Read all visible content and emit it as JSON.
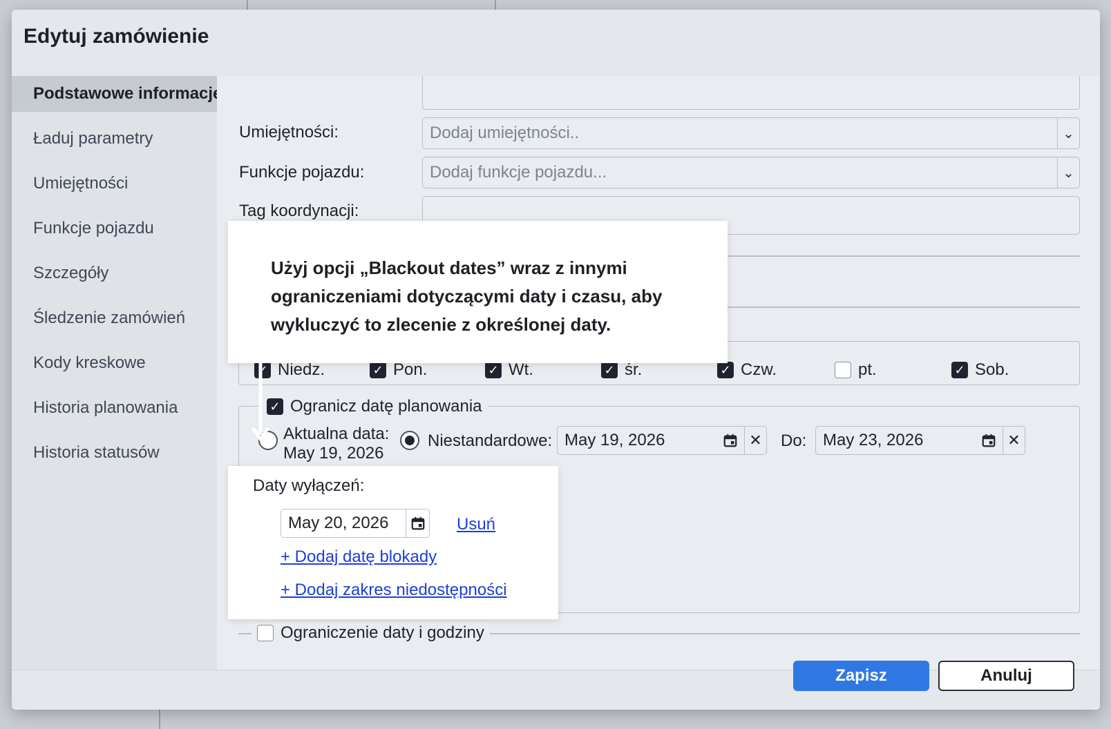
{
  "dialog": {
    "title": "Edytuj zamówienie"
  },
  "sidebar": {
    "items": [
      {
        "label": "Podstawowe informacje",
        "active": true
      },
      {
        "label": "Ładuj parametry"
      },
      {
        "label": "Umiejętności"
      },
      {
        "label": "Funkcje pojazdu"
      },
      {
        "label": "Szczegóły"
      },
      {
        "label": "Śledzenie zamówień"
      },
      {
        "label": "Kody kreskowe"
      },
      {
        "label": "Historia planowania"
      },
      {
        "label": "Historia statusów"
      }
    ]
  },
  "form": {
    "skills_label": "Umiejętności:",
    "skills_placeholder": "Dodaj umiejętności..",
    "vehicle_label": "Funkcje pojazdu:",
    "vehicle_placeholder": "Dodaj funkcje pojazdu...",
    "coord_label": "Tag koordynacji:"
  },
  "days": [
    {
      "label": "Niedz.",
      "checked": true
    },
    {
      "label": "Pon.",
      "checked": true
    },
    {
      "label": "Wt.",
      "checked": true
    },
    {
      "label": "śr.",
      "checked": true
    },
    {
      "label": "Czw.",
      "checked": true
    },
    {
      "label": "pt.",
      "checked": false
    },
    {
      "label": "Sob.",
      "checked": true
    }
  ],
  "schedule": {
    "limit_label": "Ogranicz datę planowania",
    "limit_checked": true,
    "current_label": "Aktualna data:",
    "current_value": "May 19, 2026",
    "custom_label": "Niestandardowe:",
    "from_date": "May 19, 2026",
    "to_label": "Do:",
    "to_date": "May 23, 2026"
  },
  "blackout": {
    "label": "Daty wyłączeń:",
    "date": "May 20, 2026",
    "remove_label": "Usuń",
    "add_date_label": "+ Dodaj datę blokady",
    "add_range_label": "+ Dodaj zakres niedostępności"
  },
  "datetime_limit": {
    "label": "Ograniczenie daty i godziny",
    "checked": false
  },
  "tooltip": {
    "text": "Użyj opcji „Blackout dates” wraz z innymi ograniczeniami dotyczącymi daty i czasu, aby wykluczyć to zlecenie z określonej daty."
  },
  "footer": {
    "save_label": "Zapisz",
    "cancel_label": "Anuluj"
  },
  "colors": {
    "primary": "#2f78e4",
    "link": "#1c3fd6"
  }
}
